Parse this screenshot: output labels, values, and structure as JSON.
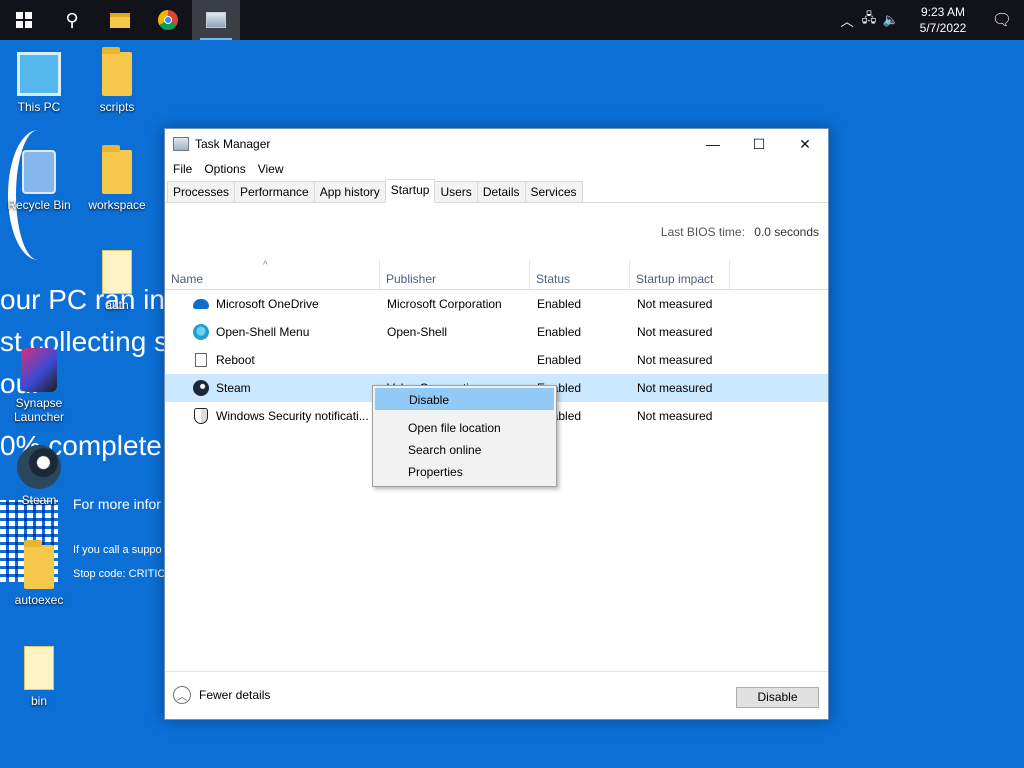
{
  "taskbar": {
    "start": "start-button",
    "search_icon": "search-icon",
    "pinned": [
      "file-explorer",
      "chrome",
      "task-manager"
    ],
    "tray_icons": [
      "chevron-up-icon",
      "network-icon",
      "volume-icon"
    ],
    "time": "9:23 AM",
    "date": "5/7/2022",
    "notification_icon": "notification-icon"
  },
  "wallpaper": {
    "line1": "our PC ran int",
    "line2": "st collecting s",
    "line3": "ou.",
    "line4": "0% complete",
    "more_info": "For more infor",
    "call": "If you call a suppo",
    "stop": "Stop code: CRITICA"
  },
  "desktop_icons": [
    {
      "label": "This PC"
    },
    {
      "label": "scripts"
    },
    {
      "label": "Recycle Bin"
    },
    {
      "label": "workspace"
    },
    {
      "label": "auth"
    },
    {
      "label": "Synapse Launcher"
    },
    {
      "label": "Steam"
    },
    {
      "label": "autoexec"
    },
    {
      "label": "bin"
    }
  ],
  "task_manager": {
    "title": "Task Manager",
    "menu": [
      "File",
      "Options",
      "View"
    ],
    "tabs": [
      "Processes",
      "Performance",
      "App history",
      "Startup",
      "Users",
      "Details",
      "Services"
    ],
    "selected_tab": "Startup",
    "bios_label": "Last BIOS time:",
    "bios_value": "0.0 seconds",
    "columns": [
      "Name",
      "Publisher",
      "Status",
      "Startup impact"
    ],
    "rows": [
      {
        "name": "Microsoft OneDrive",
        "publisher": "Microsoft Corporation",
        "status": "Enabled",
        "impact": "Not measured"
      },
      {
        "name": "Open-Shell Menu",
        "publisher": "Open-Shell",
        "status": "Enabled",
        "impact": "Not measured"
      },
      {
        "name": "Reboot",
        "publisher": "",
        "status": "Enabled",
        "impact": "Not measured"
      },
      {
        "name": "Steam",
        "publisher": "Valve Corporation",
        "status": "Enabled",
        "impact": "Not measured"
      },
      {
        "name": "Windows Security notificati...",
        "publisher": "",
        "status": "Enabled",
        "impact": "Not measured"
      }
    ],
    "fewer_details": "Fewer details",
    "disable_button": "Disable"
  },
  "context_menu": {
    "items": [
      "Disable",
      "Open file location",
      "Search online",
      "Properties"
    ]
  }
}
